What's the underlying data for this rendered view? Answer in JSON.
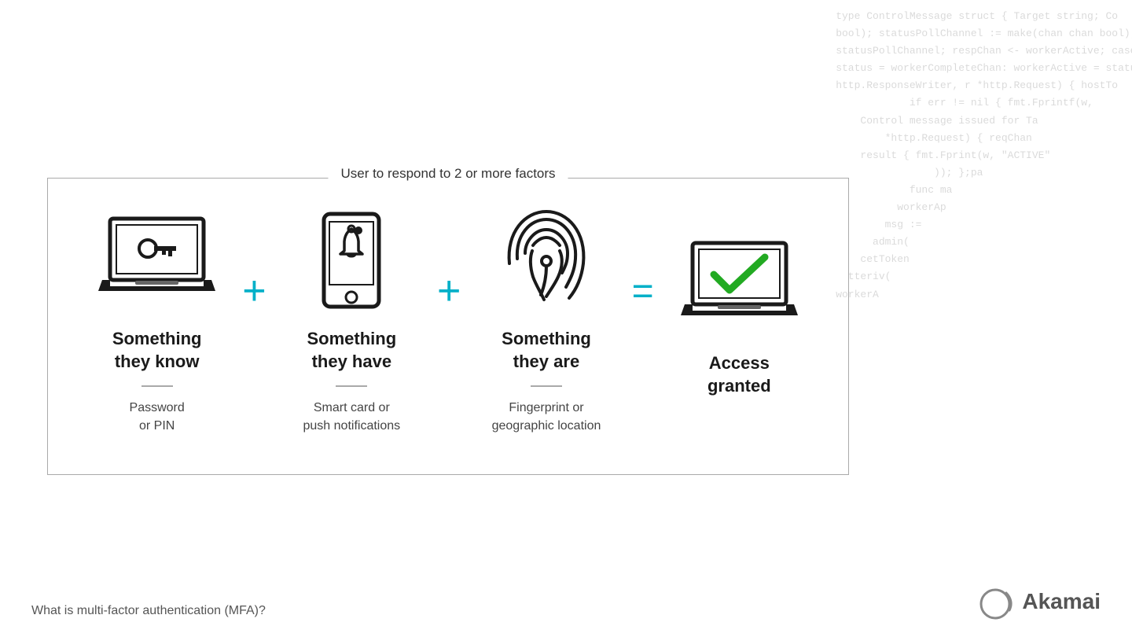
{
  "code_background": {
    "lines": [
      "type ControlMessage struct { Target string; Co",
      "bool); statusPollChannel := make(chan chan bool); v",
      "statusPollChannel; respChan <- workerActive; case",
      "status = workerCompleteChan: workerActive = status;",
      "http.ResponseWriter, r *http.Request) { hostTo",
      "if err != nil { fmt.Fprintf(w,",
      "Control message issued for Ta",
      "*http.Request) { reqChan",
      "result { fmt.Fprint(w, \"ACTIVE\"",
      ")); };pa",
      "func ma",
      "workerAp",
      "msg :=",
      "admin(",
      "cetToken",
      "tteriv(",
      "workerA"
    ]
  },
  "box_label": "User to respond to 2 or more factors",
  "factors": [
    {
      "id": "know",
      "title": "Something\nthey know",
      "subtitle": "Password\nor PIN",
      "icon_type": "laptop-key"
    },
    {
      "id": "have",
      "title": "Something\nthey have",
      "subtitle": "Smart card or\npush notifications",
      "icon_type": "phone-bell"
    },
    {
      "id": "are",
      "title": "Something\nthey are",
      "subtitle": "Fingerprint or\ngeographic location",
      "icon_type": "fingerprint"
    }
  ],
  "result": {
    "title": "Access\ngranted",
    "icon_type": "laptop-check"
  },
  "operators": {
    "plus": "+",
    "equals": "="
  },
  "footer_text": "What is multi-factor authentication (MFA)?",
  "akamai_label": "Akamai"
}
